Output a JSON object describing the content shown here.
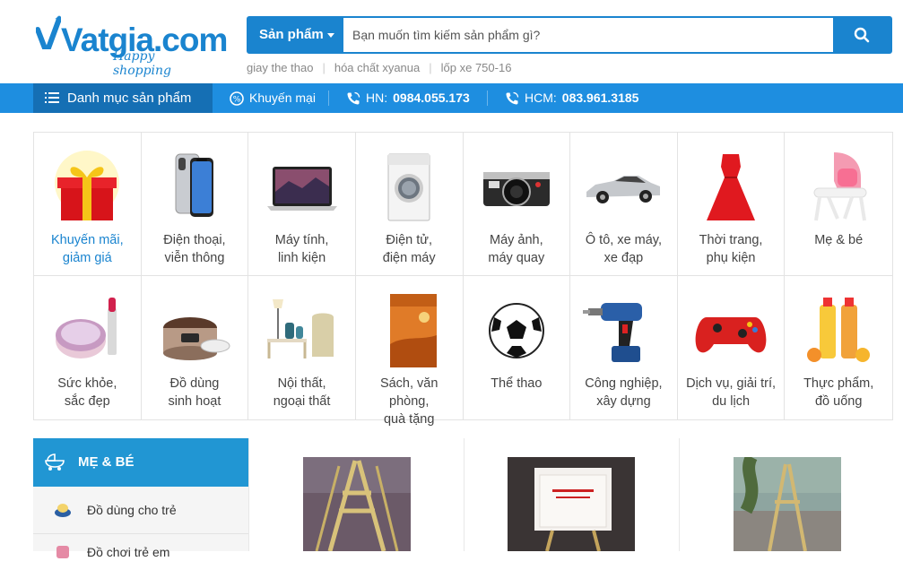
{
  "logo": {
    "brand": "Vatgia.com",
    "tagline": "Happy shopping"
  },
  "search": {
    "category_label": "Sản phẩm",
    "placeholder": "Bạn muốn tìm kiếm sản phẩm gì?",
    "suggestions": [
      "giay the thao",
      "hóa chất xyanua",
      "lốp xe 750-16"
    ]
  },
  "nav": {
    "category_menu": "Danh mục sản phẩm",
    "promo": "Khuyến mại",
    "hn_label": "HN:",
    "hn_phone": "0984.055.173",
    "hcm_label": "HCM:",
    "hcm_phone": "083.961.3185"
  },
  "categories": [
    {
      "line1": "Khuyến mãi,",
      "line2": "giảm giá",
      "icon": "gift-icon"
    },
    {
      "line1": "Điện thoại,",
      "line2": "viễn thông",
      "icon": "phone-icon"
    },
    {
      "line1": "Máy tính,",
      "line2": "linh kiện",
      "icon": "laptop-icon"
    },
    {
      "line1": "Điện tử,",
      "line2": "điện máy",
      "icon": "washing-machine-icon"
    },
    {
      "line1": "Máy ảnh,",
      "line2": "máy quay",
      "icon": "camera-icon"
    },
    {
      "line1": "Ô tô, xe máy,",
      "line2": "xe đạp",
      "icon": "car-icon"
    },
    {
      "line1": "Thời trang,",
      "line2": "phụ kiện",
      "icon": "dress-icon"
    },
    {
      "line1": "Mẹ & bé",
      "line2": "",
      "icon": "baby-chair-icon"
    },
    {
      "line1": "Sức khỏe,",
      "line2": "sắc đẹp",
      "icon": "cosmetics-icon"
    },
    {
      "line1": "Đồ dùng",
      "line2": "sinh hoạt",
      "icon": "rice-cooker-icon"
    },
    {
      "line1": "Nội thất,",
      "line2": "ngoại thất",
      "icon": "furniture-icon"
    },
    {
      "line1": "Sách, văn phòng,",
      "line2": "quà tặng",
      "icon": "book-icon"
    },
    {
      "line1": "Thể thao",
      "line2": "",
      "icon": "soccer-ball-icon"
    },
    {
      "line1": "Công nghiệp,",
      "line2": "xây dựng",
      "icon": "drill-icon"
    },
    {
      "line1": "Dịch vụ, giải trí,",
      "line2": "du lịch",
      "icon": "gamepad-icon"
    },
    {
      "line1": "Thực phẩm,",
      "line2": "đồ uống",
      "icon": "juice-icon"
    }
  ],
  "sidebar": {
    "title": "MẸ & BÉ",
    "items": [
      "Đồ dùng cho trẻ",
      "Đồ chơi trẻ em"
    ]
  },
  "colors": {
    "brand": "#1a84cf",
    "nav": "#1e8ee0",
    "nav_dark": "#156fb4",
    "sidebar_head": "#2196d3"
  }
}
